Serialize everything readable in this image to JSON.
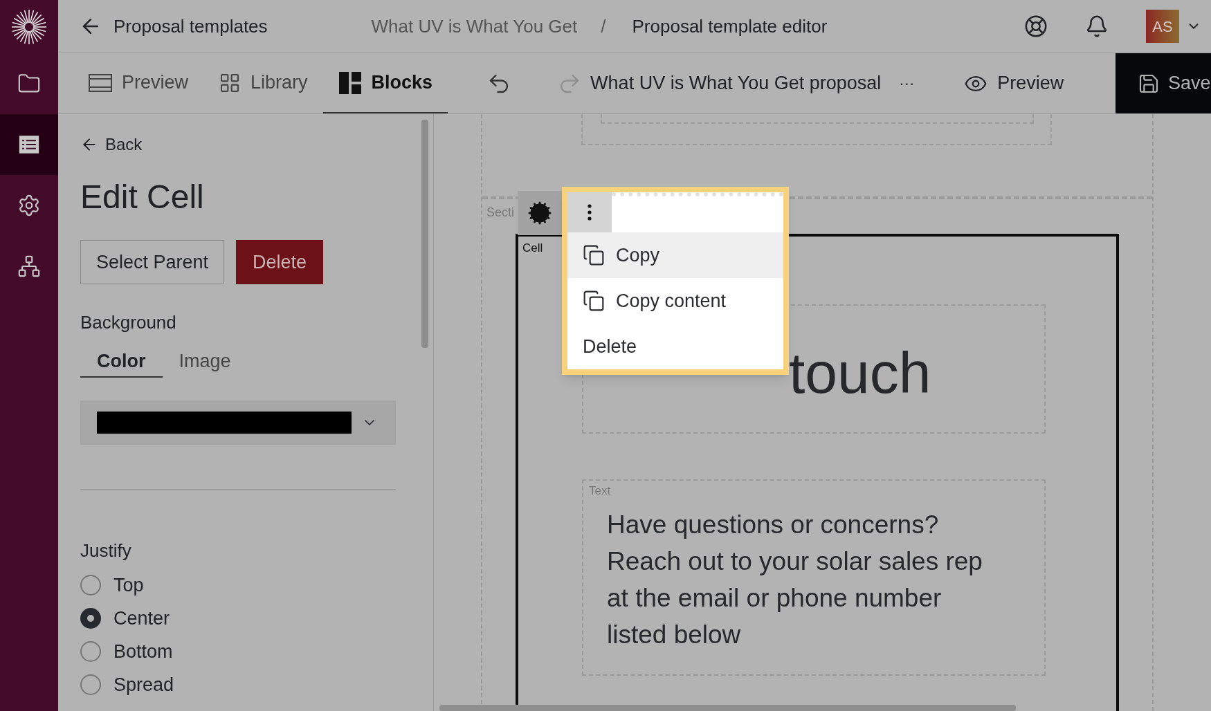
{
  "sidebar": {
    "items": [
      {
        "selected": false
      },
      {
        "selected": true
      },
      {
        "selected": false
      },
      {
        "selected": false
      }
    ]
  },
  "header": {
    "back_label": "Proposal templates",
    "breadcrumb": [
      "What UV is What You Get",
      "Proposal template editor"
    ],
    "separator": "/",
    "avatar": "AS"
  },
  "toolbar": {
    "tabs": [
      {
        "label": "Preview",
        "selected": false
      },
      {
        "label": "Library",
        "selected": false
      },
      {
        "label": "Blocks",
        "selected": true
      }
    ],
    "undo": {
      "disabled": false
    },
    "redo": {
      "disabled": true
    },
    "document_title": "What UV is What You Get proposal",
    "more": "···",
    "preview": "Preview",
    "save": "Save"
  },
  "panel": {
    "back": "Back",
    "title": "Edit Cell",
    "buttons": [
      "Select Parent",
      "Delete"
    ],
    "background_label": "Background",
    "tabs": [
      {
        "label": "Color",
        "selected": true
      },
      {
        "label": "Image",
        "selected": false
      }
    ],
    "justify_label": "Justify",
    "justify_options": [
      {
        "label": "Top",
        "selected": false
      },
      {
        "label": "Center",
        "selected": true
      },
      {
        "label": "Bottom",
        "selected": false
      },
      {
        "label": "Spread",
        "selected": false
      }
    ]
  },
  "canvas": {
    "section_label": "Secti",
    "cell_label": "Cell",
    "heading": "touch",
    "text_label": "Text",
    "text_body": "Have questions or concerns? Reach out to your solar sales rep at the email or phone number listed below"
  },
  "context_menu": {
    "items": [
      {
        "label": "Copy",
        "kind": "icon",
        "highlighted": true
      },
      {
        "label": "Copy content",
        "kind": "icon",
        "highlighted": false
      },
      {
        "label": "Delete",
        "kind": "plain",
        "highlighted": false
      }
    ]
  }
}
